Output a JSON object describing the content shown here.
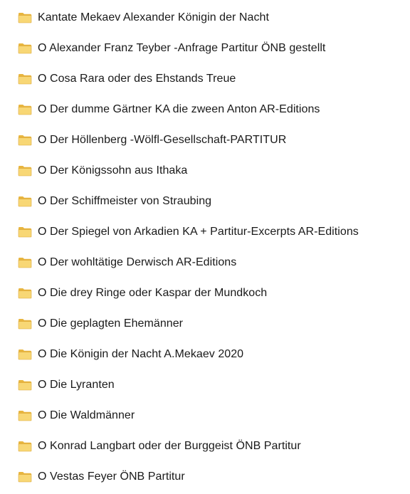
{
  "folders": [
    {
      "name": "Kantate Mekaev Alexander Königin der Nacht",
      "icon": "folder-icon"
    },
    {
      "name": "O Alexander Franz Teyber -Anfrage Partitur ÖNB gestellt",
      "icon": "folder-icon"
    },
    {
      "name": "O Cosa Rara oder des Ehstands Treue",
      "icon": "folder-icon"
    },
    {
      "name": "O Der dumme Gärtner KA die zween Anton AR-Editions",
      "icon": "folder-icon"
    },
    {
      "name": "O Der Höllenberg -Wölfl-Gesellschaft-PARTITUR",
      "icon": "folder-icon"
    },
    {
      "name": "O Der Königssohn aus Ithaka",
      "icon": "folder-icon"
    },
    {
      "name": "O Der Schiffmeister von Straubing",
      "icon": "folder-icon"
    },
    {
      "name": "O Der Spiegel von Arkadien KA + Partitur-Excerpts AR-Editions",
      "icon": "folder-icon"
    },
    {
      "name": "O Der wohltätige Derwisch AR-Editions",
      "icon": "folder-icon"
    },
    {
      "name": "O Die drey Ringe oder Kaspar der Mundkoch",
      "icon": "folder-icon"
    },
    {
      "name": "O Die geplagten Ehemänner",
      "icon": "folder-icon"
    },
    {
      "name": "O Die Königin der Nacht A.Mekaev 2020",
      "icon": "folder-icon"
    },
    {
      "name": "O Die Lyranten",
      "icon": "folder-icon"
    },
    {
      "name": "O Die Waldmänner",
      "icon": "folder-icon"
    },
    {
      "name": "O Konrad Langbart oder der Burggeist ÖNB Partitur",
      "icon": "folder-icon"
    },
    {
      "name": "O Vestas Feyer ÖNB Partitur",
      "icon": "folder-icon"
    }
  ],
  "colors": {
    "folder_body": "#f8d775",
    "folder_back": "#e8b53f",
    "folder_edge": "#dba83a"
  }
}
